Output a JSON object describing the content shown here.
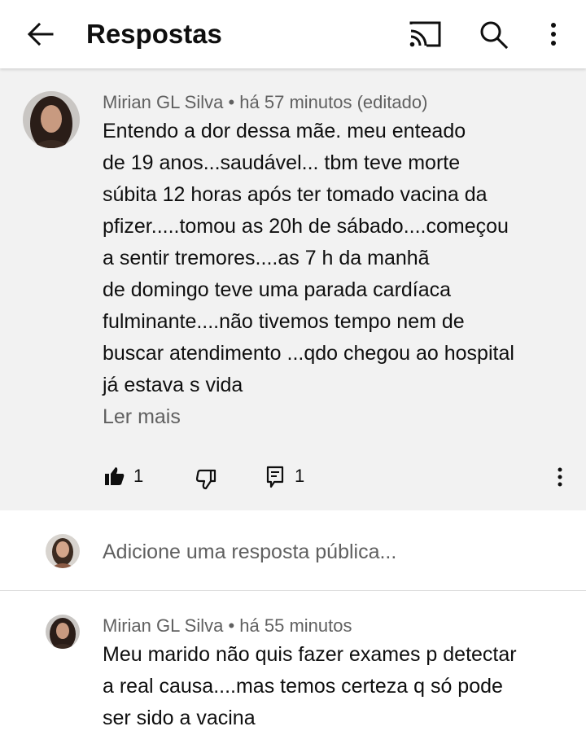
{
  "appbar": {
    "title": "Respostas",
    "icons": [
      "back-arrow-icon",
      "cast-icon",
      "search-icon",
      "more-vert-icon"
    ]
  },
  "main_comment": {
    "author": "Mirian GL Silva",
    "meta": "• há 57 minutos (editado)",
    "lines": [
      "Entendo a dor dessa mãe. meu enteado",
      "de 19 anos...saudável... tbm teve morte",
      "súbita 12 horas após ter tomado vacina da",
      "pfizer.....tomou as 20h de sábado....começou",
      "a sentir tremores....as 7 h da manhã",
      "de domingo teve uma parada cardíaca",
      "fulminante....não tivemos  tempo nem de",
      "buscar atendimento ...qdo chegou ao hospital",
      "já estava s vida"
    ],
    "read_more": "Ler mais",
    "like_count": "1",
    "reply_count": "1"
  },
  "reply_box": {
    "placeholder": "Adicione uma resposta pública..."
  },
  "reply": {
    "author": "Mirian GL Silva",
    "meta": "• há 55 minutos",
    "lines": [
      "Meu marido não quis fazer exames p detectar",
      "a real causa....mas temos certeza q só pode",
      "ser sido a vacina"
    ]
  },
  "colors": {
    "comment_bg": "#f2f2f2",
    "text_primary": "#0f0f0f",
    "text_secondary": "#606060"
  }
}
